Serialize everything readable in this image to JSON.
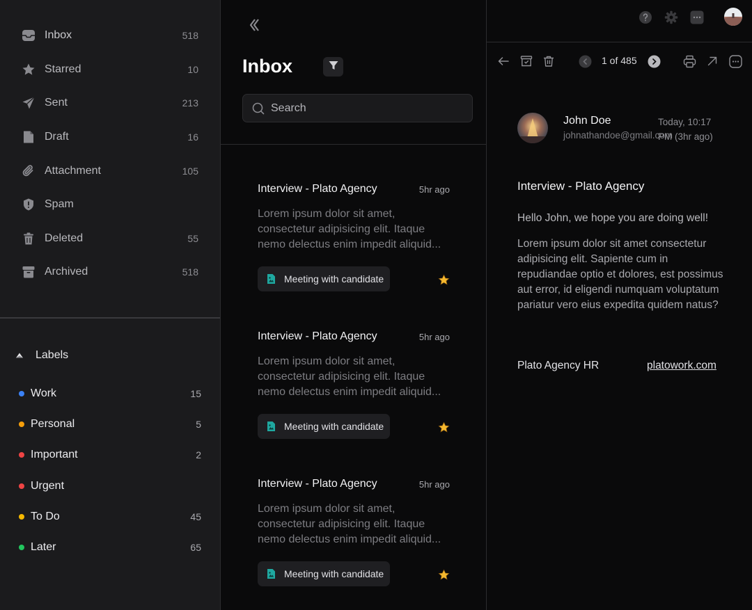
{
  "sidebar": {
    "folders": [
      {
        "label": "Inbox",
        "count": "518",
        "icon": "inbox-icon"
      },
      {
        "label": "Starred",
        "count": "10",
        "icon": "star-icon"
      },
      {
        "label": "Sent",
        "count": "213",
        "icon": "send-icon"
      },
      {
        "label": "Draft",
        "count": "16",
        "icon": "draft-icon"
      },
      {
        "label": "Attachment",
        "count": "105",
        "icon": "paperclip-icon"
      },
      {
        "label": "Spam",
        "count": "",
        "icon": "shield-icon"
      },
      {
        "label": "Deleted",
        "count": "55",
        "icon": "trash-icon"
      },
      {
        "label": "Archived",
        "count": "518",
        "icon": "archive-icon"
      }
    ],
    "labels_heading": "Labels",
    "labels": [
      {
        "label": "Work",
        "count": "15",
        "color": "#3b82f6"
      },
      {
        "label": "Personal",
        "count": "5",
        "color": "#f59e0b"
      },
      {
        "label": "Important",
        "count": "2",
        "color": "#ef4444"
      },
      {
        "label": "Urgent",
        "count": "",
        "color": "#ef4444"
      },
      {
        "label": "To Do",
        "count": "45",
        "color": "#f5b800"
      },
      {
        "label": "Later",
        "count": "65",
        "color": "#22c55e"
      }
    ]
  },
  "list": {
    "title": "Inbox",
    "search_placeholder": "Search",
    "mails": [
      {
        "subject": "Interview - Plato Agency",
        "time": "5hr ago",
        "preview": "Lorem ipsum dolor sit amet, consectetur adipisicing elit. Itaque nemo delectus enim impedit aliquid...",
        "tag": "Meeting with candidate"
      },
      {
        "subject": "Interview - Plato Agency",
        "time": "5hr ago",
        "preview": "Lorem ipsum dolor sit amet, consectetur adipisicing elit. Itaque nemo delectus enim impedit aliquid...",
        "tag": "Meeting with candidate"
      },
      {
        "subject": "Interview - Plato Agency",
        "time": "5hr ago",
        "preview": "Lorem ipsum dolor sit amet, consectetur adipisicing elit. Itaque nemo delectus enim impedit aliquid...",
        "tag": "Meeting with candidate"
      }
    ]
  },
  "detail": {
    "pager": "1 of 485",
    "sender_name": "John Doe",
    "sender_email": "johnathandoe@gmail.com",
    "date": "Today, 10:17 PM (3hr ago)",
    "subject": "Interview - Plato Agency",
    "greeting": "Hello John, we hope you are doing well!",
    "body": "Lorem ipsum dolor sit amet consectetur adipisicing elit. Sapiente cum in repudiandae optio et dolores, est possimus aut error, id eligendi numquam voluptatum pariatur vero eius expedita quidem natus?",
    "signature": "Plato Agency HR",
    "link": "platowork.com"
  }
}
